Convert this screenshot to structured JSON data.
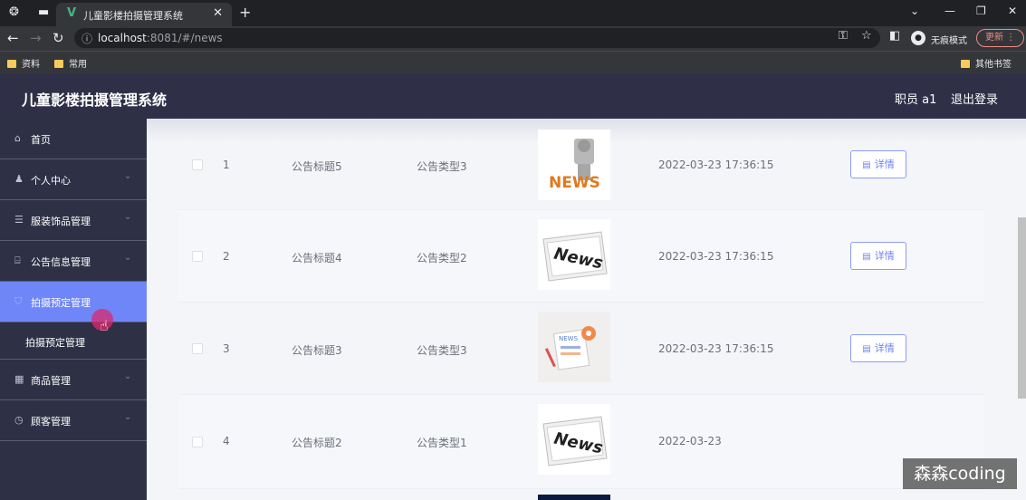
{
  "browser": {
    "tab_title": "儿童影楼拍摄管理系统",
    "url_host": "localhost",
    "url_rest": ":8081/#/news",
    "profile_label": "无痕模式",
    "update_label": "更新",
    "bookmarks": [
      "资料",
      "常用"
    ],
    "other_bookmarks": "其他书签"
  },
  "header": {
    "title": "儿童影楼拍摄管理系统",
    "user": "职员 a1",
    "logout": "退出登录"
  },
  "sidebar": {
    "items": [
      {
        "label": "首页",
        "icon": "home-icon"
      },
      {
        "label": "个人中心",
        "icon": "user-icon"
      },
      {
        "label": "服装饰品管理",
        "icon": "list-icon"
      },
      {
        "label": "公告信息管理",
        "icon": "bank-icon"
      },
      {
        "label": "拍摄预定管理",
        "icon": "shield-icon"
      },
      {
        "label": "商品管理",
        "icon": "goods-icon"
      },
      {
        "label": "顾客管理",
        "icon": "clock-icon"
      }
    ],
    "submenu_label": "拍摄预定管理"
  },
  "table": {
    "rows": [
      {
        "index": "1",
        "title": "公告标题5",
        "type": "公告类型3",
        "time": "2022-03-23 17:36:15",
        "image": "news-statue-image"
      },
      {
        "index": "2",
        "title": "公告标题4",
        "type": "公告类型2",
        "time": "2022-03-23 17:36:15",
        "image": "news-paper-image"
      },
      {
        "index": "3",
        "title": "公告标题3",
        "type": "公告类型3",
        "time": "2022-03-23 17:36:15",
        "image": "news-document-image"
      },
      {
        "index": "4",
        "title": "公告标题2",
        "type": "公告类型1",
        "time": "2022-03-23",
        "image": "news-paper-image"
      }
    ],
    "detail_label": "详情"
  },
  "watermark": "森森coding"
}
